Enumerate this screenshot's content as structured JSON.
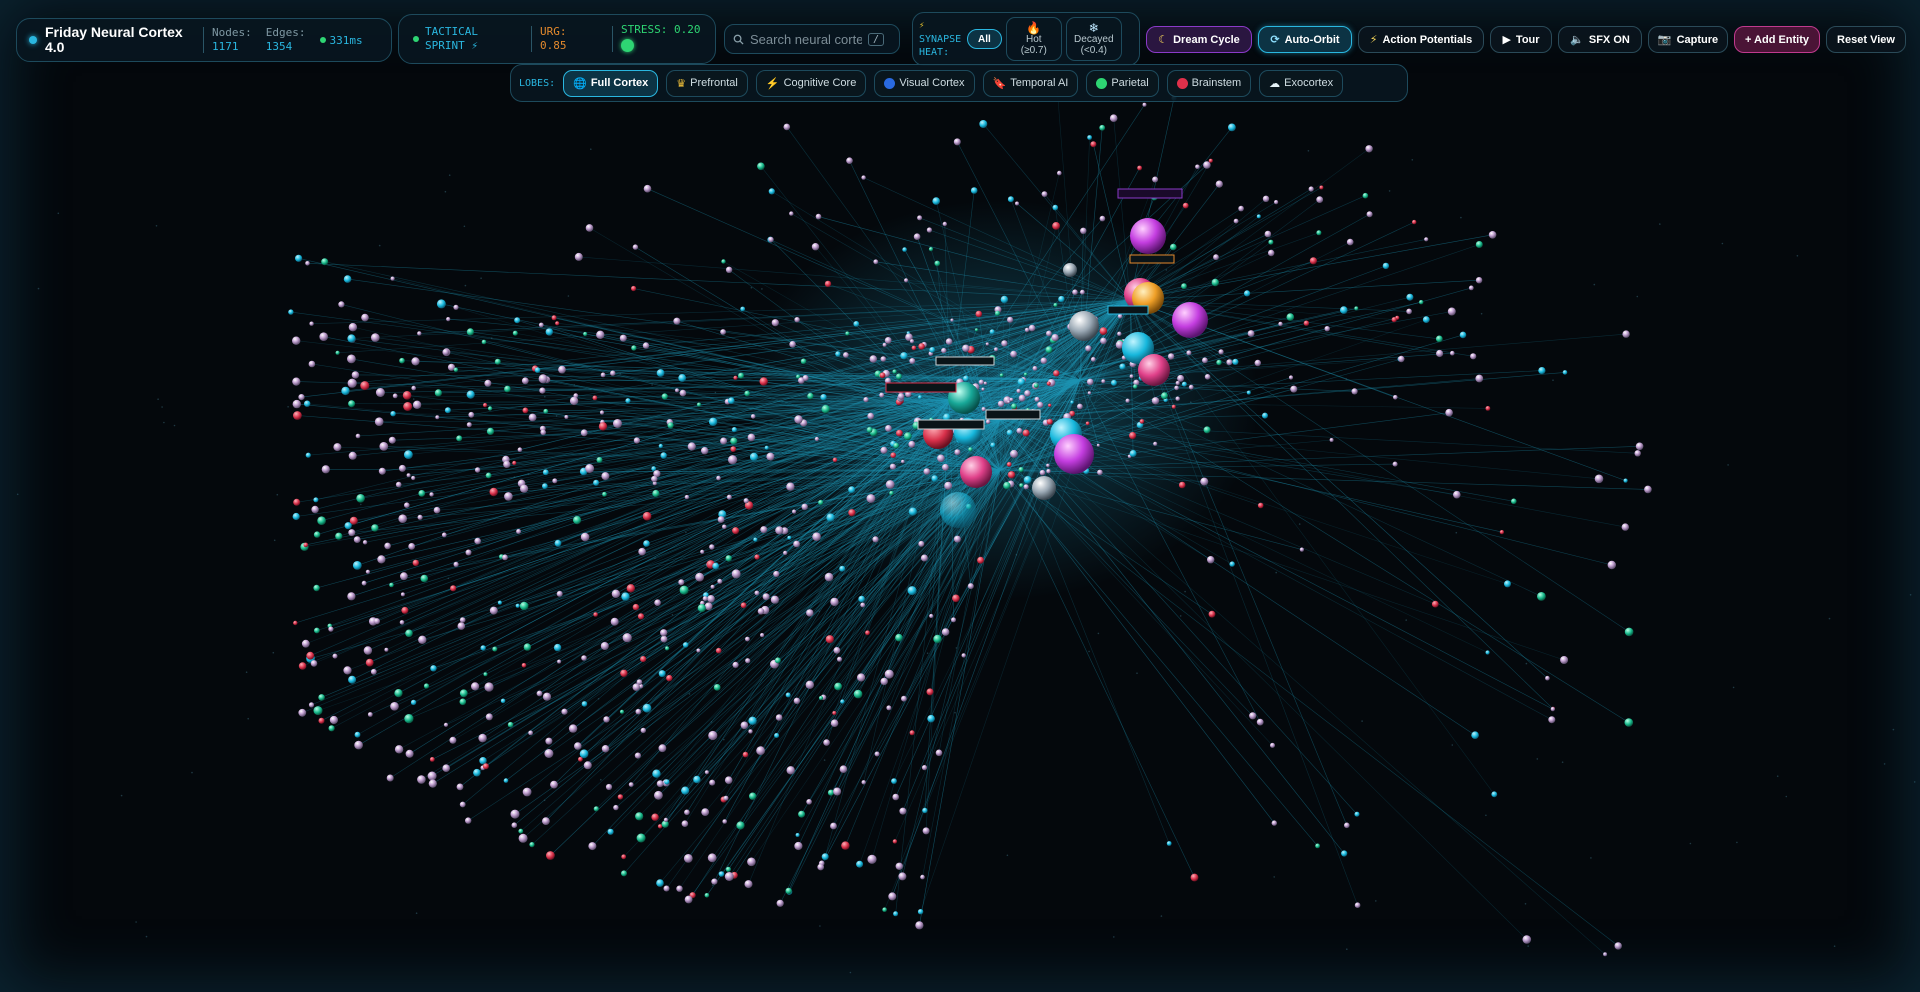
{
  "brand": {
    "title_line1": "Friday Neural Cortex",
    "title_line2": "4.0"
  },
  "stats": {
    "nodes_label": "Nodes:",
    "nodes_value": "1171",
    "edges_label": "Edges:",
    "edges_value": "1354",
    "latency": "331ms"
  },
  "mode": {
    "name_line1": "TACTICAL",
    "name_line2": "SPRINT ⚡",
    "urg_label": "URG:",
    "urg_value": "0.85",
    "stress": "STRESS: 0.20"
  },
  "search": {
    "placeholder": "Search neural cortex...",
    "shortcut": "/"
  },
  "synapse_heat": {
    "label_line1": "SYNAPSE",
    "label_line2": "HEAT:",
    "all": "All",
    "hot_line1": "Hot",
    "hot_line2": "(≥0.7)",
    "decayed_line1": "Decayed",
    "decayed_line2": "(<0.4)"
  },
  "toolbar": {
    "dream_cycle": "Dream Cycle",
    "auto_orbit": "Auto-Orbit",
    "action_potentials": "Action Potentials",
    "tour": "Tour",
    "sfx": "SFX ON",
    "capture": "Capture",
    "add_entity": "+ Add Entity",
    "reset_view": "Reset View"
  },
  "lobes": {
    "label": "LOBES:",
    "items": [
      {
        "label": "Full Cortex",
        "icon": "globe-icon",
        "active": true
      },
      {
        "label": "Prefrontal",
        "icon": "crown-icon"
      },
      {
        "label": "Cognitive Core",
        "icon": "lightning-icon"
      },
      {
        "label": "Visual Cortex",
        "icon": "blue-circle-icon"
      },
      {
        "label": "Temporal AI",
        "icon": "bookmark-icon"
      },
      {
        "label": "Parietal",
        "icon": "green-circle-icon"
      },
      {
        "label": "Brainstem",
        "icon": "red-circle-icon"
      },
      {
        "label": "Exocortex",
        "icon": "cloud-icon"
      }
    ]
  },
  "colors": {
    "accent": "#2ab7e0",
    "edge": "#1b8aa6",
    "urgent": "#e3892d",
    "stress": "#2ed573",
    "dream": "#8a3ac8",
    "add_entity": "#c03a8e"
  }
}
